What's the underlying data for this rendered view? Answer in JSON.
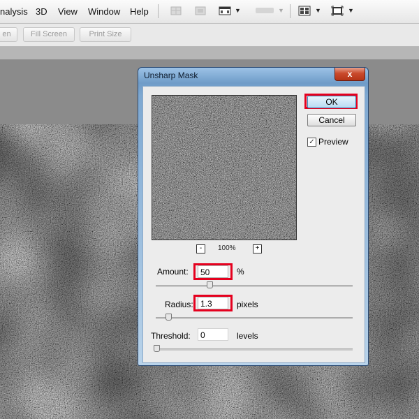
{
  "menu": {
    "items": [
      "nalysis",
      "3D",
      "View",
      "Window",
      "Help"
    ]
  },
  "options_bar": {
    "buttons": [
      "en",
      "Fill Screen",
      "Print Size"
    ]
  },
  "dialog": {
    "title": "Unsharp Mask",
    "close_label": "x",
    "zoom": {
      "minus": "-",
      "value": "100%",
      "plus": "+"
    },
    "ok_label": "OK",
    "cancel_label": "Cancel",
    "preview": {
      "label": "Preview",
      "checked": true,
      "check_glyph": "✓"
    },
    "amount": {
      "label": "Amount:",
      "value": "50",
      "unit": "%",
      "slider": 0.27
    },
    "radius": {
      "label": "Radius:",
      "value": "1.3",
      "unit": "pixels",
      "slider": 0.06
    },
    "threshold": {
      "label": "Threshold:",
      "value": "0",
      "unit": "levels",
      "slider": 0.0
    }
  }
}
